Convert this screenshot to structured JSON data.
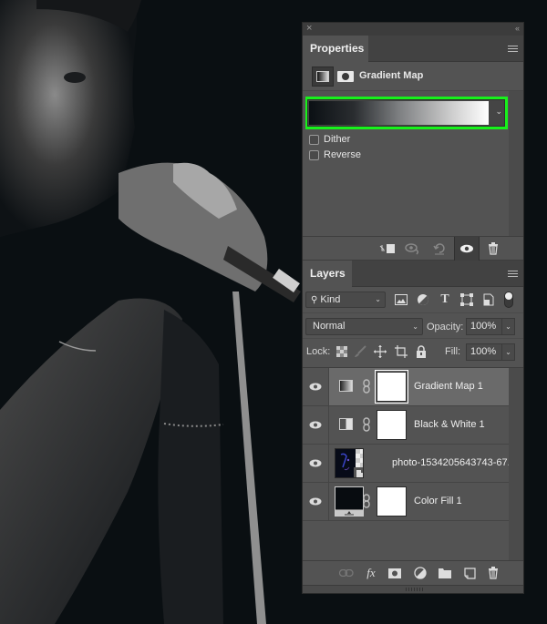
{
  "canvas": {
    "description": "Black and white photo of a man holding a microphone",
    "background_color": "#0a0f12"
  },
  "panel": {
    "close_glyph": "×",
    "collapse_glyph": "‹‹",
    "properties": {
      "tab_label": "Properties",
      "adjustment_title": "Gradient Map",
      "gradient": {
        "colors": [
          "#0b1014",
          "#7d7f81",
          "#ffffff"
        ],
        "highlight_color": "#17f21b"
      },
      "dither_label": "Dither",
      "dither_checked": false,
      "reverse_label": "Reverse",
      "reverse_checked": false,
      "footer_icons": [
        "clip-to-layer-icon",
        "view-previous-state-icon",
        "reset-icon",
        "visibility-icon",
        "delete-icon"
      ]
    },
    "layers": {
      "tab_label": "Layers",
      "filter_kind": "Kind",
      "blend_mode": "Normal",
      "opacity_label": "Opacity:",
      "opacity_value": "100%",
      "lock_label": "Lock:",
      "fill_label": "Fill:",
      "fill_value": "100%",
      "items": [
        {
          "name": "Gradient Map 1",
          "type": "gradient-map",
          "visible": true,
          "selected": true
        },
        {
          "name": "Black & White 1",
          "type": "black-white",
          "visible": true,
          "selected": false
        },
        {
          "name": "photo-1534205643743-67...",
          "type": "smart-object",
          "visible": true,
          "selected": false
        },
        {
          "name": "Color Fill 1",
          "type": "color-fill",
          "visible": true,
          "selected": false
        }
      ],
      "footer_icons": [
        "link-layers-icon",
        "fx-icon",
        "add-mask-icon",
        "adjustment-layer-icon",
        "group-icon",
        "new-layer-icon",
        "delete-layer-icon"
      ]
    }
  }
}
